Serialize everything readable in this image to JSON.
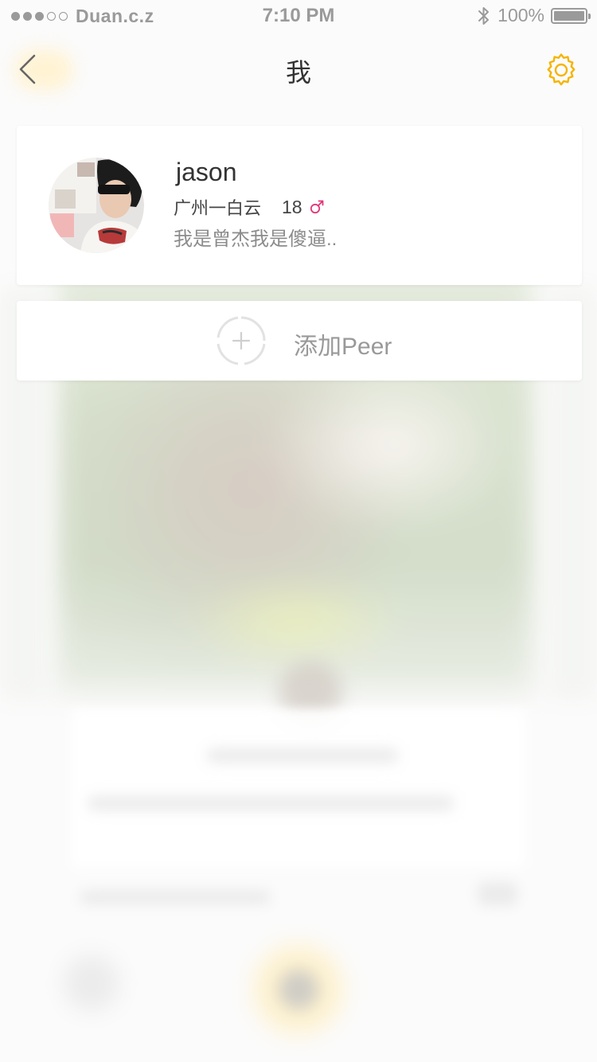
{
  "status_bar": {
    "carrier": "Duan.c.z",
    "time": "7:10 PM",
    "battery": "100%"
  },
  "nav": {
    "title": "我",
    "back_icon": "chevron-left-icon",
    "settings_icon": "gear-icon"
  },
  "profile": {
    "name": "jason",
    "location": "广州一白云",
    "age": "18",
    "gender_icon": "male-symbol-icon",
    "bio": "我是曾杰我是傻逼..",
    "avatar": "user-avatar-photo"
  },
  "add_peer": {
    "label": "添加Peer",
    "icon": "add-circle-icon"
  },
  "colors": {
    "accent": "#f5b400",
    "gender_male": "#e0387a",
    "background": "#f7f7f7",
    "card": "#ffffff",
    "muted_text": "#999999"
  }
}
